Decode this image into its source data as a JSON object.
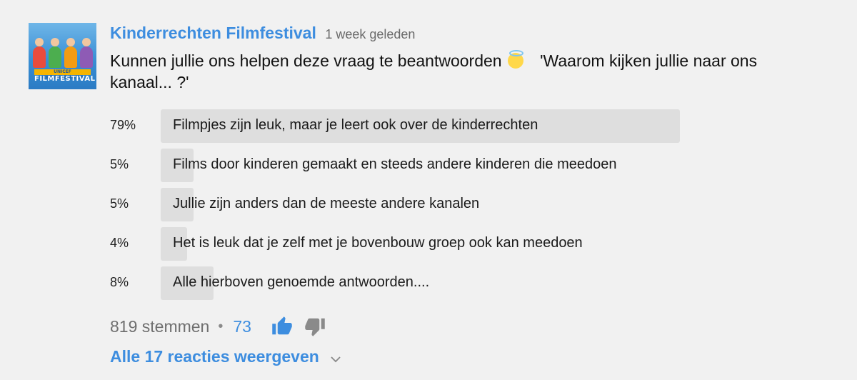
{
  "channel": {
    "name": "Kinderrechten Filmfestival",
    "time": "1 week geleden",
    "avatar": {
      "top_text": "UNICEF KINDERRECHTEN",
      "bottom_text": "FILMFESTIVAL"
    }
  },
  "question": {
    "part1": "Kunnen jullie ons helpen deze vraag te beantwoorden",
    "emoji": "smiling-face-with-halo",
    "part2": "'Waarom kijken jullie naar ons kanaal... ?'"
  },
  "poll": {
    "options": [
      {
        "percent_label": "79%",
        "percent": 79,
        "label": "Filmpjes zijn leuk, maar je leert ook over de kinderrechten"
      },
      {
        "percent_label": "5%",
        "percent": 5,
        "label": "Films door kinderen gemaakt en steeds andere kinderen die meedoen"
      },
      {
        "percent_label": "5%",
        "percent": 5,
        "label": "Jullie zijn anders dan de meeste andere kanalen"
      },
      {
        "percent_label": "4%",
        "percent": 4,
        "label": "Het is leuk dat je zelf met je bovenbouw groep ook kan meedoen"
      },
      {
        "percent_label": "8%",
        "percent": 8,
        "label": "Alle hierboven genoemde antwoorden...."
      }
    ]
  },
  "footer": {
    "votes": "819 stemmen",
    "separator": "•",
    "likes": "73",
    "like_icon": "thumbs-up-icon",
    "dislike_icon": "thumbs-down-icon"
  },
  "replies": {
    "label": "Alle 17 reacties weergeven",
    "icon": "chevron-down-icon"
  },
  "colors": {
    "accent": "#3d8ddf",
    "bar": "#dedede",
    "background": "#f1f1f1"
  }
}
